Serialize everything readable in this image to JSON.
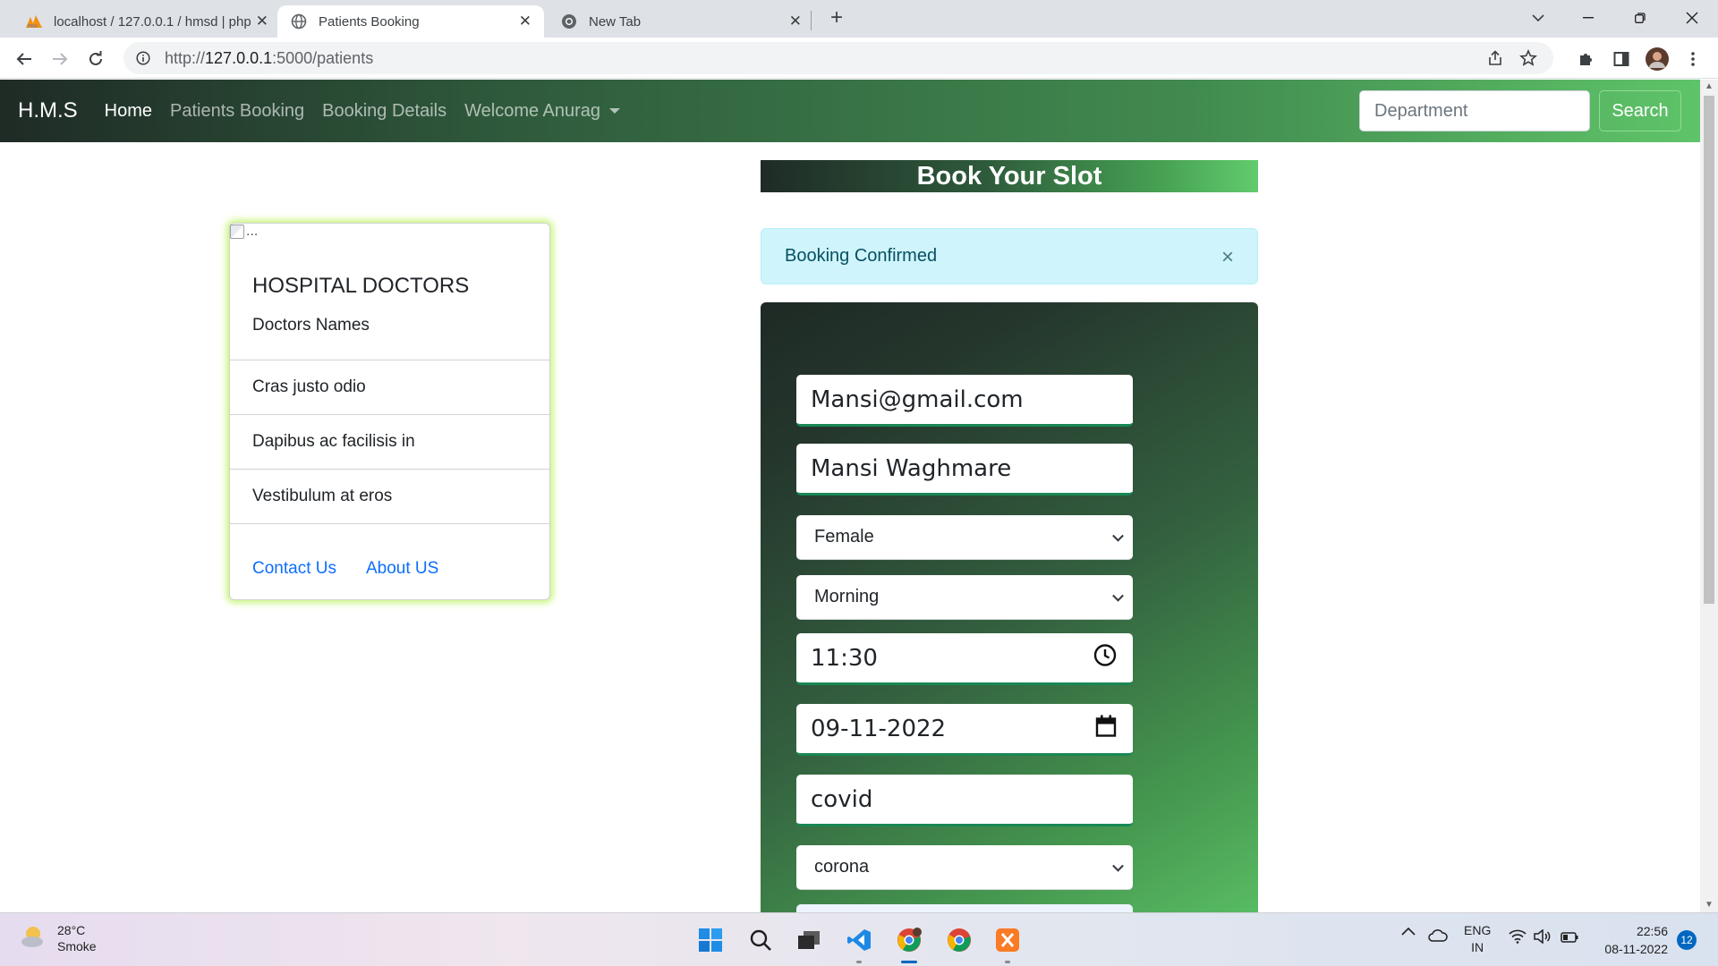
{
  "browser": {
    "tabs": [
      {
        "title": "localhost / 127.0.0.1 / hmsd | php",
        "icon": "phpmyadmin-icon"
      },
      {
        "title": "Patients Booking",
        "icon": "globe-icon",
        "active": true
      },
      {
        "title": "New Tab",
        "icon": "chrome-icon"
      }
    ],
    "url_prefix": "http://",
    "url_host": "127.0.0.1",
    "url_path": ":5000/patients"
  },
  "navbar": {
    "brand": "H.M.S",
    "links": [
      "Home",
      "Patients Booking",
      "Booking Details",
      "Welcome Anurag"
    ],
    "search_placeholder": "Department",
    "search_button": "Search"
  },
  "card": {
    "img_alt": "...",
    "title": "HOSPITAL DOCTORS",
    "text": "Doctors Names",
    "items": [
      "Cras justo odio",
      "Dapibus ac facilisis in",
      "Vestibulum at eros"
    ],
    "links": [
      "Contact Us",
      "About US"
    ]
  },
  "booking": {
    "heading": "Book Your Slot",
    "alert": "Booking Confirmed",
    "alert_close": "×",
    "email": "Mansi@gmail.com",
    "name": "Mansi Waghmare",
    "gender": "Female",
    "shift": "Morning",
    "time": "11:30",
    "date": "09-11-2022",
    "disease": "covid",
    "department": "corona"
  },
  "taskbar": {
    "temperature": "28°C",
    "weather": "Smoke",
    "lang_top": "ENG",
    "lang_bottom": "IN",
    "time": "22:56",
    "date": "08-11-2022",
    "notifications": "12"
  },
  "colors": {
    "nav_gradient_start": "#1f2b26",
    "nav_gradient_end": "#5fc469",
    "card_glow": "#c6f57a",
    "alert_bg": "#cff4fc",
    "field_accent": "#198754"
  }
}
